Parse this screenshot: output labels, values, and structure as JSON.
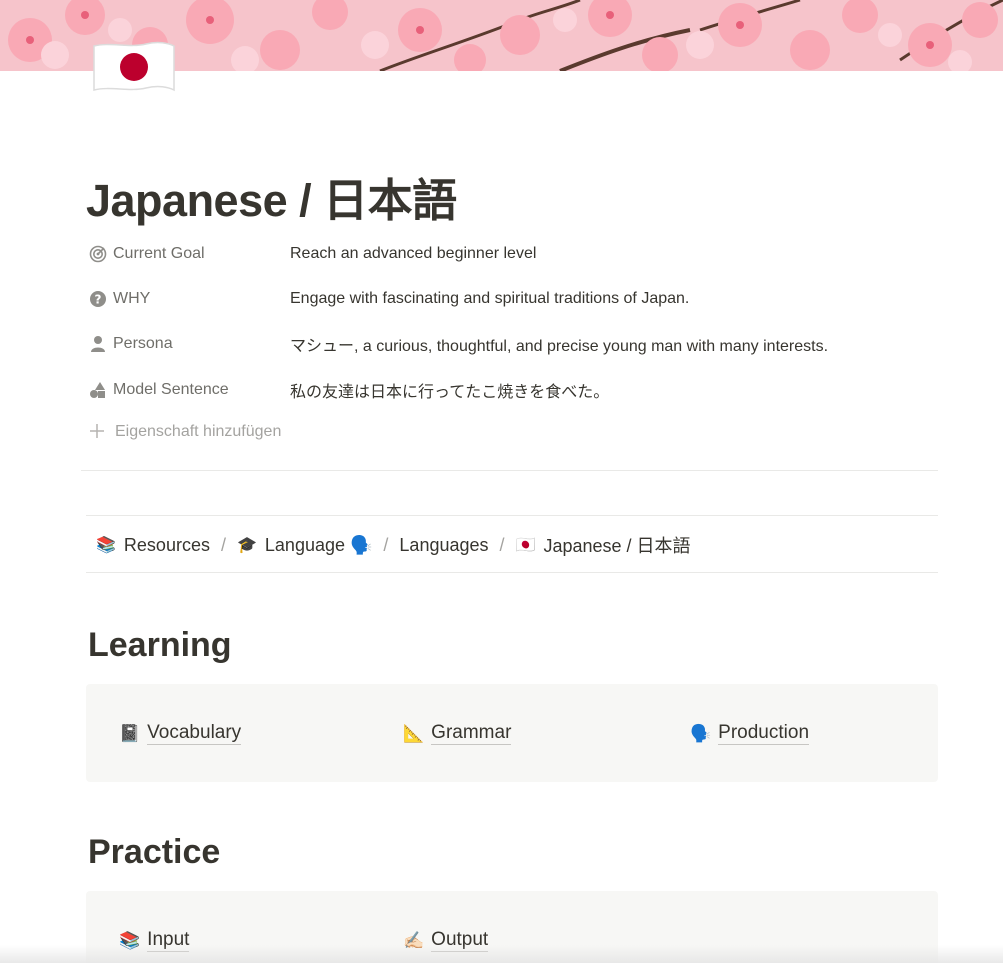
{
  "page": {
    "title": "Japanese / 日本語",
    "icon": "japan-flag-icon"
  },
  "properties": [
    {
      "name": "Current Goal",
      "icon": "target-icon",
      "value": "Reach an advanced beginner level"
    },
    {
      "name": "WHY",
      "icon": "question-circle-icon",
      "value": "Engage with fascinating and spiritual traditions of Japan."
    },
    {
      "name": "Persona",
      "icon": "person-icon",
      "value": "マシュー, a curious, thoughtful, and precise young man with many interests."
    },
    {
      "name": "Model Sentence",
      "icon": "shapes-icon",
      "value": "私の友達は日本に行ってたこ焼きを食べた。"
    }
  ],
  "add_property_label": "Eigenschaft hinzufügen",
  "breadcrumb": [
    {
      "emoji": "📚",
      "label": "Resources"
    },
    {
      "emoji": "🎓",
      "label": "Language 🗣️"
    },
    {
      "emoji": "",
      "label": "Languages"
    },
    {
      "emoji": "🇯🇵",
      "label": "Japanese / 日本語"
    }
  ],
  "breadcrumb_separator": "/",
  "sections": {
    "learning": {
      "heading": "Learning",
      "links": [
        {
          "emoji": "📓",
          "label": "Vocabulary"
        },
        {
          "emoji": "📐",
          "label": "Grammar"
        },
        {
          "emoji": "🗣️",
          "label": "Production"
        }
      ]
    },
    "practice": {
      "heading": "Practice",
      "links": [
        {
          "emoji": "📚",
          "label": "Input"
        },
        {
          "emoji": "✍🏻",
          "label": "Output"
        }
      ]
    }
  },
  "colors": {
    "text": "#37352f",
    "muted": "#6f6e69",
    "faint": "#a4a3a0",
    "callout_bg": "#f7f7f5",
    "cover_pink": "#f4bcc4",
    "flag_red": "#bc002d"
  }
}
